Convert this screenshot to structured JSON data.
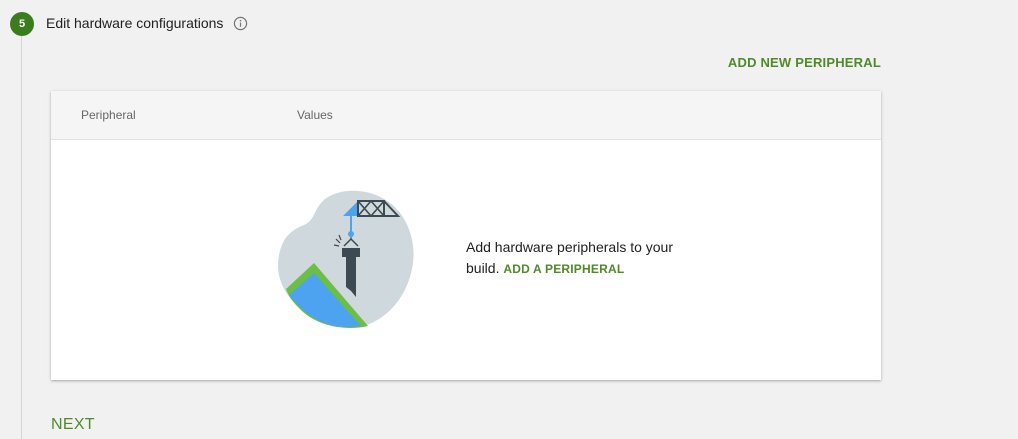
{
  "step": {
    "number": "5",
    "title": "Edit hardware configurations",
    "info_icon": "info-icon"
  },
  "actions": {
    "add_new_peripheral": "ADD NEW PERIPHERAL",
    "next": "NEXT"
  },
  "table": {
    "columns": [
      "Peripheral",
      "Values"
    ],
    "empty_state": {
      "message": "Add hardware peripherals to your build.",
      "link_label": "ADD A PERIPHERAL",
      "illustration": "crane-illustration"
    }
  },
  "colors": {
    "accent_green": "#4f8a29",
    "badge_green": "#3a7d1c",
    "illustration_blue": "#4da3ef",
    "illustration_grey": "#cfd8dc",
    "illustration_dark": "#3d4a52",
    "illustration_lime": "#6cbf45"
  }
}
